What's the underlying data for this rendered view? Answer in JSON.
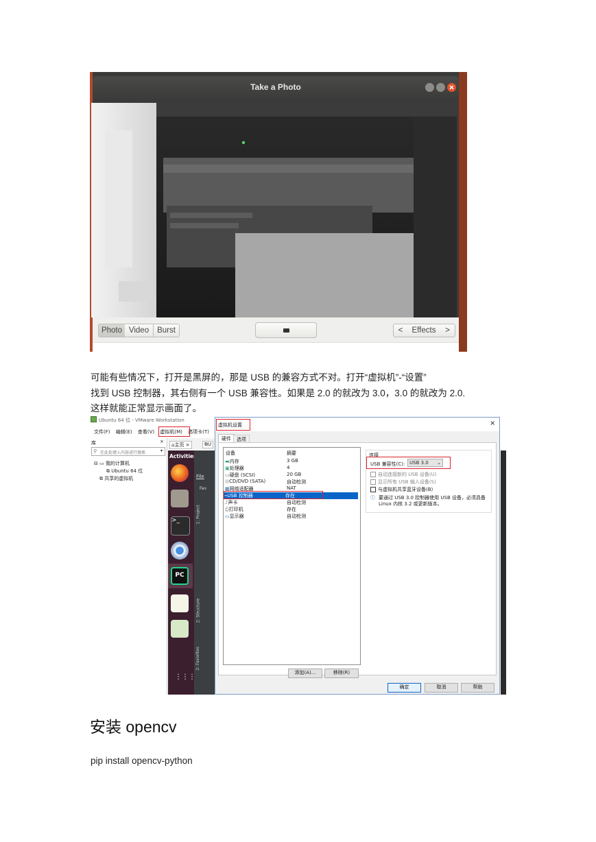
{
  "screenshot1": {
    "title": "Take a Photo",
    "modes": [
      "Photo",
      "Video",
      "Burst"
    ],
    "effects_label": "Effects"
  },
  "paragraphs": {
    "line1": "可能有些情况下，打开是黑屏的，那是 USB 的兼容方式不对。打开“虚拟机”-“设置”",
    "line2": "找到 USB 控制器，其右侧有一个  USB 兼容性。如果是 2.0 的就改为 3.0，3.0 的就改为 2.0.",
    "line3": "这样就能正常显示画面了。"
  },
  "screenshot2": {
    "window_title": "Ubuntu 64 位 - VMware Workstation",
    "menu": [
      "文件(F)",
      "编辑(E)",
      "查看(V)",
      "虚拟机(M)",
      "选项卡(T)"
    ],
    "library_title": "库",
    "search_placeholder": "在此处键入内容进行搜索",
    "tree": {
      "my_computer": "我的计算机",
      "vm": "Ubuntu 64 位",
      "shared": "共享的虚拟机"
    },
    "tabs": [
      "主页",
      "U"
    ],
    "activities": "Activities",
    "ide": {
      "file_menu": "File",
      "side_labels": [
        "1: Project",
        "2: Structure",
        "2: Favorites"
      ],
      "fav_label": "Fav"
    },
    "dialog": {
      "title": "虚拟机设置",
      "close": "×",
      "tabs": [
        "硬件",
        "选项"
      ],
      "col_device": "设备",
      "col_summary": "摘要",
      "devices": [
        {
          "name": "内存",
          "summary": "3 GB"
        },
        {
          "name": "处理器",
          "summary": "4"
        },
        {
          "name": "硬盘 (SCSI)",
          "summary": "20 GB"
        },
        {
          "name": "CD/DVD (SATA)",
          "summary": "自动检测"
        },
        {
          "name": "网络适配器",
          "summary": "NAT"
        },
        {
          "name": "USB 控制器",
          "summary": "存在"
        },
        {
          "name": "声卡",
          "summary": "自动检测"
        },
        {
          "name": "打印机",
          "summary": "存在"
        },
        {
          "name": "显示器",
          "summary": "自动检测"
        }
      ],
      "selected_index": 5,
      "connection_title": "连接",
      "usb_compat_label": "USB 兼容性(C):",
      "usb_compat_value": "USB 3.0",
      "options": [
        {
          "label": "自动连接新的 USB 设备(U)",
          "checked": false,
          "enabled": false
        },
        {
          "label": "显示所有 USB 输入设备(S)",
          "checked": false,
          "enabled": false
        },
        {
          "label": "与虚拟机共享蓝牙设备(B)",
          "checked": false,
          "enabled": true
        }
      ],
      "info_text_1": "要通过 USB 3.0 控制器使用 USB 设备，必须具备",
      "info_text_2": "Linux 内核 3.2 或更新版本。",
      "add_button": "添加(A)...",
      "remove_button": "移除(R)",
      "ok_button": "确定",
      "cancel_button": "取消",
      "help_button": "帮助"
    },
    "colors": {
      "ubuntu_dock": "#3b1f2e",
      "selection": "#0a64c8",
      "highlight_box": "#d8232a"
    }
  },
  "heading": "安装 opencv",
  "code_line": "pip install opencv-python"
}
